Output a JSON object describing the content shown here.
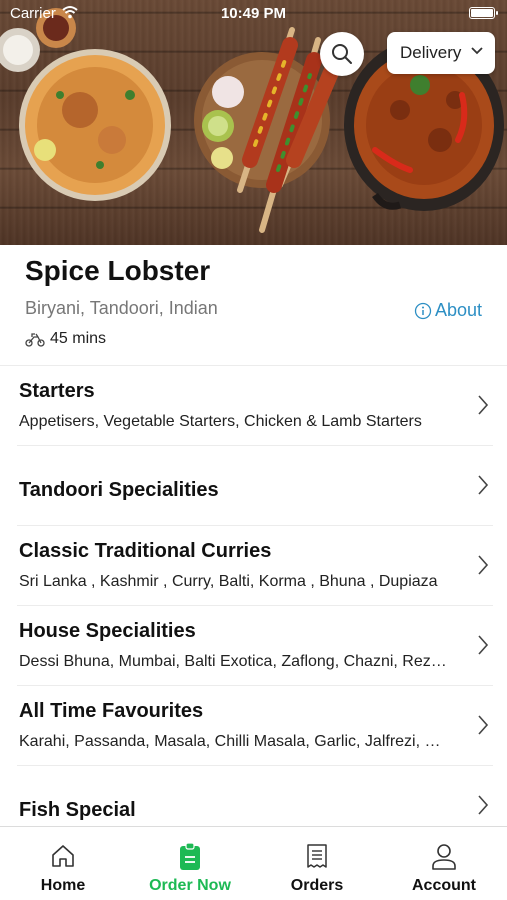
{
  "status_bar": {
    "carrier": "Carrier",
    "time": "10:49 PM"
  },
  "header": {
    "delivery_label": "Delivery",
    "search_icon": "search-icon"
  },
  "restaurant": {
    "name": "Spice Lobster",
    "cuisines": "Biryani, Tandoori, Indian",
    "about_label": "About",
    "delivery_time": "45 mins"
  },
  "menu": {
    "categories": [
      {
        "title": "Starters",
        "subtitle": "Appetisers, Vegetable Starters, Chicken & Lamb Starters"
      },
      {
        "title": "Tandoori Specialities",
        "subtitle": ""
      },
      {
        "title": "Classic Traditional Curries",
        "subtitle": "Sri Lanka , Kashmir , Curry, Balti, Korma , Bhuna , Dupiaza"
      },
      {
        "title": "House Specialities",
        "subtitle": "Dessi Bhuna, Mumbai, Balti Exotica, Zaflong, Chazni, Rezala"
      },
      {
        "title": "All Time Favourites",
        "subtitle": "Karahi, Passanda, Masala, Chilli Masala, Garlic, Jalfrezi, Pathia"
      },
      {
        "title": "Fish Special",
        "subtitle": ""
      }
    ]
  },
  "tabbar": {
    "tabs": [
      {
        "label": "Home",
        "icon": "home-icon"
      },
      {
        "label": "Order Now",
        "icon": "order-icon"
      },
      {
        "label": "Orders",
        "icon": "receipt-icon"
      },
      {
        "label": "Account",
        "icon": "person-icon"
      }
    ],
    "active_color": "#1db954"
  },
  "colors": {
    "accent_link": "#2d8fc4",
    "active_tab": "#1db954"
  }
}
